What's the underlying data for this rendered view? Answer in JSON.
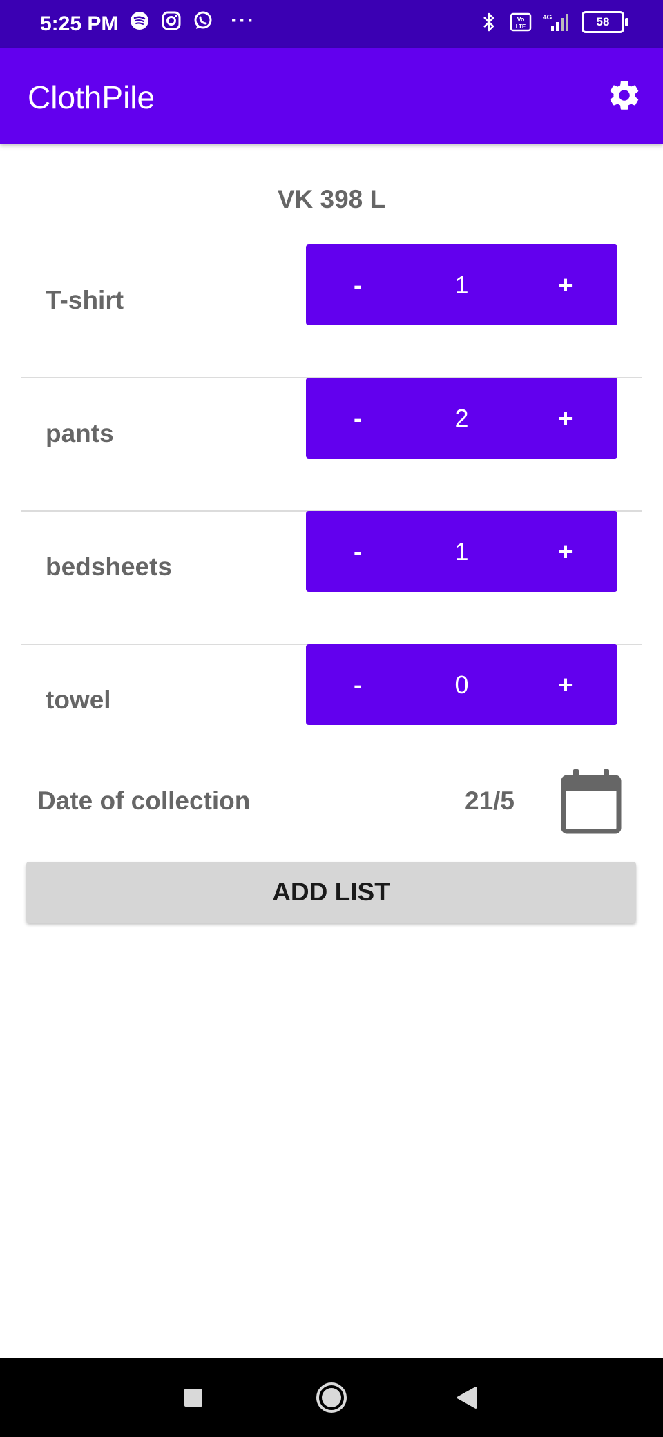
{
  "status_bar": {
    "time": "5:25 PM",
    "battery": "58",
    "left_icons": [
      "spotify-icon",
      "instagram-icon",
      "whatsapp-icon"
    ],
    "more": "···",
    "right_icons": [
      "bluetooth-icon",
      "volte-icon",
      "signal-4g-icon",
      "battery-icon"
    ]
  },
  "app_bar": {
    "title": "ClothPile",
    "settings_icon": "gear-icon"
  },
  "heading": "VK 398 L",
  "items": [
    {
      "label": "T-shirt",
      "minus": "-",
      "count": "1",
      "plus": "+"
    },
    {
      "label": "pants",
      "minus": "-",
      "count": "2",
      "plus": "+"
    },
    {
      "label": "bedsheets",
      "minus": "-",
      "count": "1",
      "plus": "+"
    },
    {
      "label": "towel",
      "minus": "-",
      "count": "0",
      "plus": "+"
    }
  ],
  "collection": {
    "label": "Date of collection",
    "date": "21/5",
    "calendar_icon": "calendar-icon"
  },
  "add_button": "ADD LIST",
  "nav": [
    "recents-square-icon",
    "home-circle-icon",
    "back-triangle-icon"
  ],
  "colors": {
    "primary": "#6200ee",
    "status_bar": "#3b00b3",
    "label_gray": "#666666",
    "button_gray": "#d6d6d6"
  }
}
